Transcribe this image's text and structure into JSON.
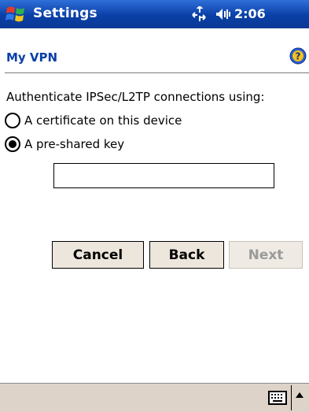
{
  "titlebar": {
    "app_title": "Settings",
    "clock": "2:06",
    "start_icon": "windows-flag-icon",
    "connectivity_icon": "connectivity-icon",
    "volume_icon": "speaker-icon"
  },
  "page": {
    "title": "My VPN",
    "help_icon": "help-icon",
    "prompt": "Authenticate IPSec/L2TP connections using:"
  },
  "options": [
    {
      "label": "A certificate on this device",
      "checked": false
    },
    {
      "label": "A pre-shared key",
      "checked": true
    }
  ],
  "key_input": {
    "value": ""
  },
  "buttons": {
    "cancel": "Cancel",
    "back": "Back",
    "next": "Next",
    "next_enabled": false
  },
  "bottombar": {
    "keyboard_icon": "keyboard-icon",
    "sip_arrow_icon": "arrow-up-icon"
  },
  "colors": {
    "titlebar": "#0b3fa6",
    "page_title": "#0b3fa6",
    "button_face": "#ece6dc",
    "bottombar": "#ddd3c8"
  }
}
